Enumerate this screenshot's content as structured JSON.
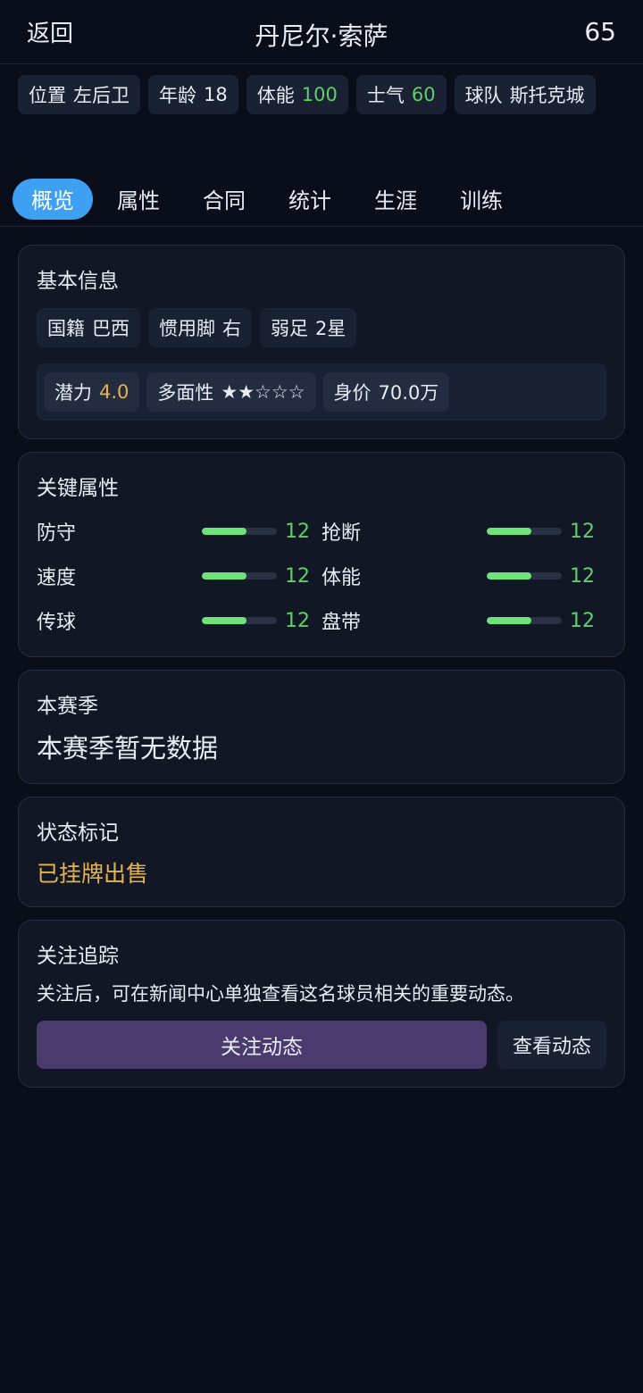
{
  "header": {
    "back_label": "返回",
    "title": "丹尼尔·索萨",
    "rating": "65"
  },
  "chips": [
    {
      "label": "位置",
      "value": "左后卫",
      "color": ""
    },
    {
      "label": "年龄",
      "value": "18",
      "color": ""
    },
    {
      "label": "体能",
      "value": "100",
      "color": "#5fcf6a"
    },
    {
      "label": "士气",
      "value": "60",
      "color": "#5fcf6a"
    },
    {
      "label": "球队",
      "value": "斯托克城",
      "color": ""
    }
  ],
  "tabs": [
    "概览",
    "属性",
    "合同",
    "统计",
    "生涯",
    "训练"
  ],
  "active_tab": "概览",
  "basic_info": {
    "title": "基本信息",
    "chips": [
      {
        "label": "国籍",
        "value": "巴西"
      },
      {
        "label": "惯用脚",
        "value": "右"
      },
      {
        "label": "弱足",
        "value": "2星"
      }
    ],
    "potential_label": "潜力",
    "potential_value": "4.0",
    "versatility_label": "多面性",
    "versatility_stars": "★★☆☆☆",
    "value_label": "身价",
    "value_value": "70.0万"
  },
  "key_attributes": {
    "title": "关键属性",
    "items": [
      {
        "name": "防守",
        "value": "12",
        "level": 0.6
      },
      {
        "name": "抢断",
        "value": "12",
        "level": 0.6
      },
      {
        "name": "速度",
        "value": "12",
        "level": 0.6
      },
      {
        "name": "体能",
        "value": "12",
        "level": 0.6
      },
      {
        "name": "传球",
        "value": "12",
        "level": 0.6
      },
      {
        "name": "盘带",
        "value": "12",
        "level": 0.6
      }
    ]
  },
  "season": {
    "title": "本赛季",
    "empty_text": "本赛季暂无数据"
  },
  "status": {
    "title": "状态标记",
    "text": "已挂牌出售"
  },
  "follow": {
    "title": "关注追踪",
    "description": "关注后，可在新闻中心单独查看这名球员相关的重要动态。",
    "follow_button": "关注动态",
    "view_button": "查看动态"
  }
}
